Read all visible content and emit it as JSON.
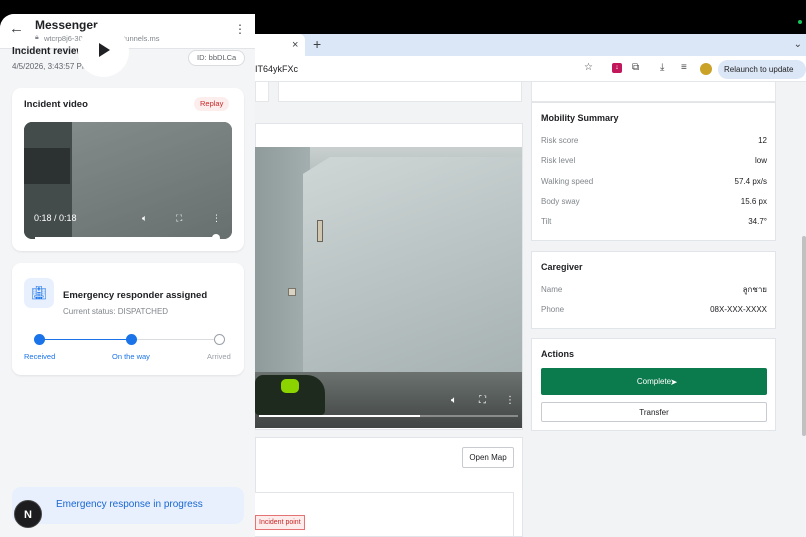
{
  "browser": {
    "tab_close": "×",
    "tab_add": "+",
    "tab_menu": "⌄",
    "url_fragment": "IT64ykFXc",
    "relaunch_label": "Relaunch to update"
  },
  "messenger": {
    "title": "Messenger",
    "url": "wtcrp8j6-3000.asse.devtunnels.ms",
    "incident_review": {
      "title": "Incident review",
      "timestamp": "4/5/2026, 3:43:57 PM",
      "id_badge": "ID: bbDLCa"
    },
    "video_card": {
      "title": "Incident video",
      "replay_label": "Replay",
      "time": "0:18 / 0:18",
      "progress": 1.0
    },
    "responder_card": {
      "title": "Emergency responder assigned",
      "status": "Current status: DISPATCHED",
      "steps": [
        {
          "label": "Received",
          "done": true
        },
        {
          "label": "On the way",
          "done": true
        },
        {
          "label": "Arrived",
          "done": false
        }
      ]
    },
    "in_progress": "Emergency response in progress",
    "avatar_letter": "N"
  },
  "page": {
    "big_video_progress": 0.62,
    "open_map_label": "Open Map",
    "incident_point_label": "Incident point",
    "mobility": {
      "title": "Mobility Summary",
      "rows": [
        {
          "label": "Risk score",
          "value": "12"
        },
        {
          "label": "Risk level",
          "value": "low"
        },
        {
          "label": "Walking speed",
          "value": "57.4 px/s"
        },
        {
          "label": "Body sway",
          "value": "15.6 px"
        },
        {
          "label": "Tilt",
          "value": "34.7°"
        }
      ]
    },
    "caregiver": {
      "title": "Caregiver",
      "rows": [
        {
          "label": "Name",
          "value": "ลูกชาย"
        },
        {
          "label": "Phone",
          "value": "08X-XXX-XXXX"
        }
      ]
    },
    "actions": {
      "title": "Actions",
      "complete_label": "Complete",
      "transfer_label": "Transfer"
    }
  },
  "colors": {
    "accent_blue": "#1a73e8",
    "complete_green": "#0b7a4c",
    "replay_red": "#c62828"
  },
  "icons": [
    "back-arrow-icon",
    "lock-icon",
    "kebab-menu-icon",
    "play-icon",
    "volume-icon",
    "fullscreen-icon",
    "hospital-icon",
    "star-icon",
    "download-icon",
    "extensions-icon",
    "cursor-icon"
  ]
}
